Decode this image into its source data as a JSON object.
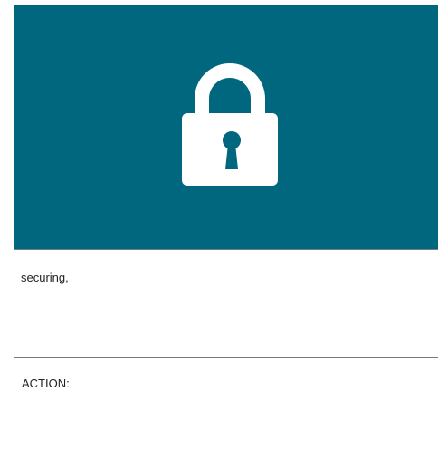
{
  "hero": {
    "icon": "lock-icon",
    "background_color": "#01677e",
    "icon_color": "#ffffff"
  },
  "sections": [
    {
      "text": "securing,"
    },
    {
      "text": "ACTION:"
    }
  ]
}
